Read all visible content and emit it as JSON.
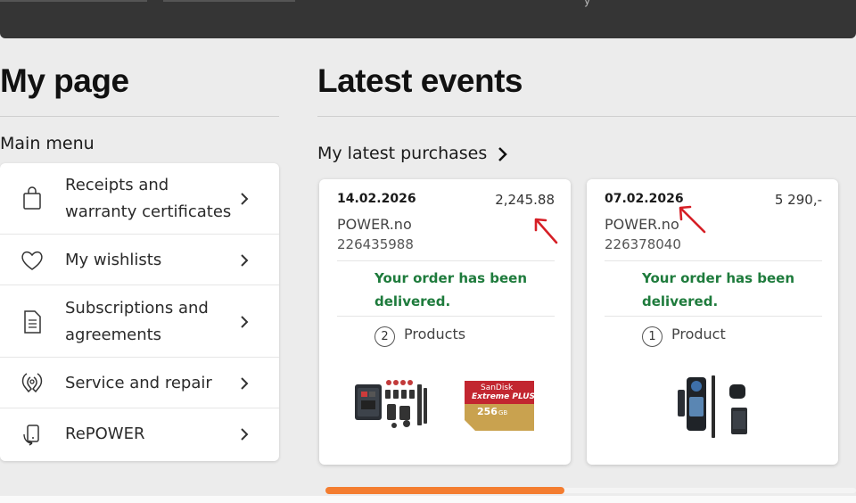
{
  "header": {
    "glyph": "y"
  },
  "left": {
    "title": "My page",
    "menu_title": "Main menu",
    "items": [
      {
        "label_line1": "Receipts and",
        "label_line2": "warranty certificates",
        "icon": "shopping-bag-icon"
      },
      {
        "label_line1": "My wishlists",
        "icon": "heart-icon"
      },
      {
        "label_line1": "Subscriptions and",
        "label_line2": "agreements",
        "icon": "document-icon"
      },
      {
        "label_line1": "Service and repair",
        "icon": "wrench-icon"
      },
      {
        "label_line1": "RePOWER",
        "icon": "recycle-device-icon"
      }
    ]
  },
  "right": {
    "title": "Latest events",
    "section_title": "My latest purchases",
    "cards": [
      {
        "date": "14.02.2026",
        "amount": "2,245.88",
        "store": "POWER.no",
        "order_number": "226435988",
        "status_line1": "Your order has been",
        "status_line2": "delivered.",
        "count": "2",
        "products_label": "Products",
        "product_images": [
          "action-camera-accessory-kit",
          "sandisk-extreme-plus-256gb-card"
        ]
      },
      {
        "date": "07.02.2026",
        "amount": "5 290,-",
        "store": "POWER.no",
        "order_number": "226378040",
        "status_line1": "Your order has been",
        "status_line2": "delivered.",
        "count": "1",
        "products_label": "Product",
        "product_images": [
          "360-camera-bundle"
        ]
      }
    ],
    "sandisk_text": {
      "brand": "SanDisk",
      "line": "Extreme PLUS",
      "size": "256",
      "unit": "GB"
    }
  },
  "scroll": {
    "position_fraction": 0.45
  },
  "colors": {
    "accent": "#f47d30",
    "status": "#1e7b3c",
    "annotation": "#d61f26"
  }
}
